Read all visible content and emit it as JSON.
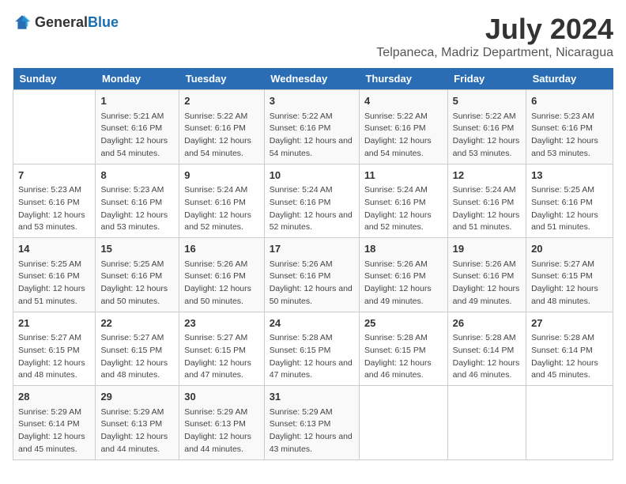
{
  "header": {
    "logo_general": "General",
    "logo_blue": "Blue",
    "main_title": "July 2024",
    "subtitle": "Telpaneca, Madriz Department, Nicaragua"
  },
  "calendar": {
    "days": [
      "Sunday",
      "Monday",
      "Tuesday",
      "Wednesday",
      "Thursday",
      "Friday",
      "Saturday"
    ],
    "weeks": [
      [
        {
          "date": "",
          "sunrise": "",
          "sunset": "",
          "daylight": ""
        },
        {
          "date": "1",
          "sunrise": "5:21 AM",
          "sunset": "6:16 PM",
          "daylight": "12 hours and 54 minutes."
        },
        {
          "date": "2",
          "sunrise": "5:22 AM",
          "sunset": "6:16 PM",
          "daylight": "12 hours and 54 minutes."
        },
        {
          "date": "3",
          "sunrise": "5:22 AM",
          "sunset": "6:16 PM",
          "daylight": "12 hours and 54 minutes."
        },
        {
          "date": "4",
          "sunrise": "5:22 AM",
          "sunset": "6:16 PM",
          "daylight": "12 hours and 54 minutes."
        },
        {
          "date": "5",
          "sunrise": "5:22 AM",
          "sunset": "6:16 PM",
          "daylight": "12 hours and 53 minutes."
        },
        {
          "date": "6",
          "sunrise": "5:23 AM",
          "sunset": "6:16 PM",
          "daylight": "12 hours and 53 minutes."
        }
      ],
      [
        {
          "date": "7",
          "sunrise": "5:23 AM",
          "sunset": "6:16 PM",
          "daylight": "12 hours and 53 minutes."
        },
        {
          "date": "8",
          "sunrise": "5:23 AM",
          "sunset": "6:16 PM",
          "daylight": "12 hours and 53 minutes."
        },
        {
          "date": "9",
          "sunrise": "5:24 AM",
          "sunset": "6:16 PM",
          "daylight": "12 hours and 52 minutes."
        },
        {
          "date": "10",
          "sunrise": "5:24 AM",
          "sunset": "6:16 PM",
          "daylight": "12 hours and 52 minutes."
        },
        {
          "date": "11",
          "sunrise": "5:24 AM",
          "sunset": "6:16 PM",
          "daylight": "12 hours and 52 minutes."
        },
        {
          "date": "12",
          "sunrise": "5:24 AM",
          "sunset": "6:16 PM",
          "daylight": "12 hours and 51 minutes."
        },
        {
          "date": "13",
          "sunrise": "5:25 AM",
          "sunset": "6:16 PM",
          "daylight": "12 hours and 51 minutes."
        }
      ],
      [
        {
          "date": "14",
          "sunrise": "5:25 AM",
          "sunset": "6:16 PM",
          "daylight": "12 hours and 51 minutes."
        },
        {
          "date": "15",
          "sunrise": "5:25 AM",
          "sunset": "6:16 PM",
          "daylight": "12 hours and 50 minutes."
        },
        {
          "date": "16",
          "sunrise": "5:26 AM",
          "sunset": "6:16 PM",
          "daylight": "12 hours and 50 minutes."
        },
        {
          "date": "17",
          "sunrise": "5:26 AM",
          "sunset": "6:16 PM",
          "daylight": "12 hours and 50 minutes."
        },
        {
          "date": "18",
          "sunrise": "5:26 AM",
          "sunset": "6:16 PM",
          "daylight": "12 hours and 49 minutes."
        },
        {
          "date": "19",
          "sunrise": "5:26 AM",
          "sunset": "6:16 PM",
          "daylight": "12 hours and 49 minutes."
        },
        {
          "date": "20",
          "sunrise": "5:27 AM",
          "sunset": "6:15 PM",
          "daylight": "12 hours and 48 minutes."
        }
      ],
      [
        {
          "date": "21",
          "sunrise": "5:27 AM",
          "sunset": "6:15 PM",
          "daylight": "12 hours and 48 minutes."
        },
        {
          "date": "22",
          "sunrise": "5:27 AM",
          "sunset": "6:15 PM",
          "daylight": "12 hours and 48 minutes."
        },
        {
          "date": "23",
          "sunrise": "5:27 AM",
          "sunset": "6:15 PM",
          "daylight": "12 hours and 47 minutes."
        },
        {
          "date": "24",
          "sunrise": "5:28 AM",
          "sunset": "6:15 PM",
          "daylight": "12 hours and 47 minutes."
        },
        {
          "date": "25",
          "sunrise": "5:28 AM",
          "sunset": "6:15 PM",
          "daylight": "12 hours and 46 minutes."
        },
        {
          "date": "26",
          "sunrise": "5:28 AM",
          "sunset": "6:14 PM",
          "daylight": "12 hours and 46 minutes."
        },
        {
          "date": "27",
          "sunrise": "5:28 AM",
          "sunset": "6:14 PM",
          "daylight": "12 hours and 45 minutes."
        }
      ],
      [
        {
          "date": "28",
          "sunrise": "5:29 AM",
          "sunset": "6:14 PM",
          "daylight": "12 hours and 45 minutes."
        },
        {
          "date": "29",
          "sunrise": "5:29 AM",
          "sunset": "6:13 PM",
          "daylight": "12 hours and 44 minutes."
        },
        {
          "date": "30",
          "sunrise": "5:29 AM",
          "sunset": "6:13 PM",
          "daylight": "12 hours and 44 minutes."
        },
        {
          "date": "31",
          "sunrise": "5:29 AM",
          "sunset": "6:13 PM",
          "daylight": "12 hours and 43 minutes."
        },
        {
          "date": "",
          "sunrise": "",
          "sunset": "",
          "daylight": ""
        },
        {
          "date": "",
          "sunrise": "",
          "sunset": "",
          "daylight": ""
        },
        {
          "date": "",
          "sunrise": "",
          "sunset": "",
          "daylight": ""
        }
      ]
    ]
  },
  "labels": {
    "sunrise_prefix": "Sunrise: ",
    "sunset_prefix": "Sunset: ",
    "daylight_prefix": "Daylight: "
  }
}
